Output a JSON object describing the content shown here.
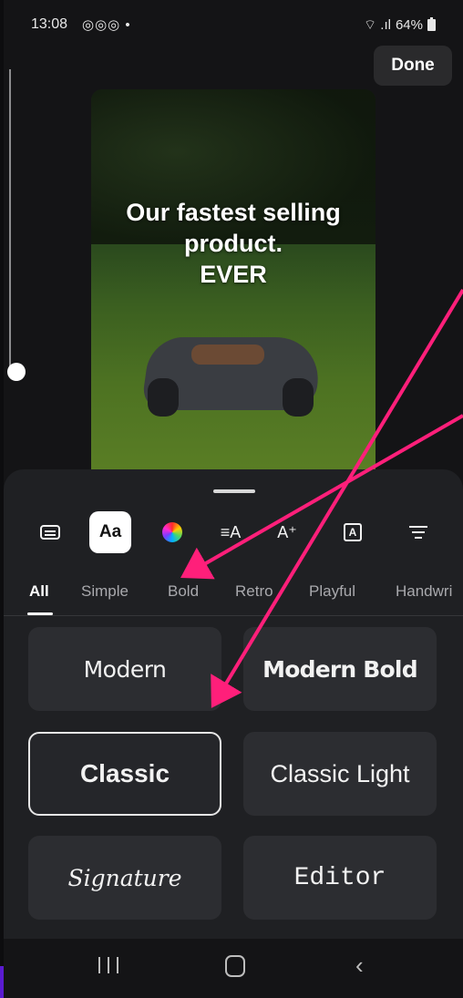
{
  "status_bar": {
    "time": "13:08",
    "notification_icons": "◎◎◎ •",
    "battery": "64%"
  },
  "editor": {
    "done_label": "Done",
    "story_text": [
      "Our fastest selling",
      "product.",
      "EVER"
    ]
  },
  "toolbar": {
    "active_font_label": "Aa",
    "items": [
      {
        "icon": "keyboard-icon"
      },
      {
        "icon": "font-style-icon",
        "active": true
      },
      {
        "icon": "color-wheel-icon"
      },
      {
        "icon": "text-animation-icon",
        "glyph": "≡A"
      },
      {
        "icon": "text-size-icon",
        "glyph": "A⁺"
      },
      {
        "icon": "text-background-icon",
        "glyph": "A"
      },
      {
        "icon": "alignment-icon"
      }
    ]
  },
  "tabs": [
    "All",
    "Simple",
    "Bold",
    "Retro",
    "Playful",
    "Handwri"
  ],
  "active_tab": "All",
  "fonts": [
    {
      "label": "Modern"
    },
    {
      "label": "Modern Bold"
    },
    {
      "label": "Classic",
      "selected": true
    },
    {
      "label": "Classic Light"
    },
    {
      "label": "Signature"
    },
    {
      "label": "Editor"
    }
  ],
  "annotation": {
    "arrow_color": "#ff1f7a"
  },
  "colors": {
    "sheet": "#1f2023",
    "card": "#2c2d31",
    "background": "#141416"
  }
}
